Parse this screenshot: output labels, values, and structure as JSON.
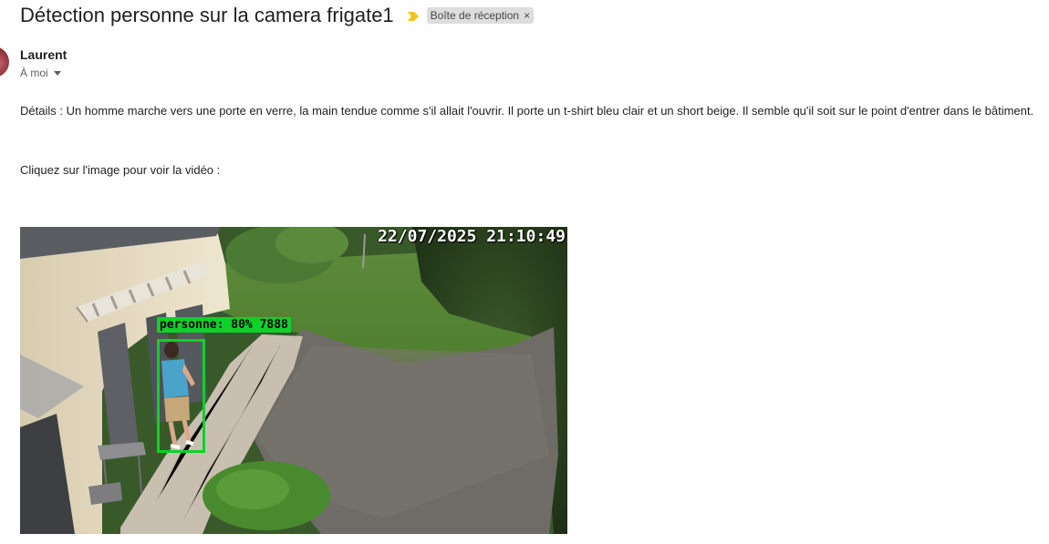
{
  "email": {
    "subject": "Détection personne sur la camera frigate1",
    "label": "Boîte de réception",
    "label_close": "×",
    "sender": "Laurent",
    "recipient": "À moi",
    "details": "Détails : Un homme marche vers une porte en verre, la main tendue comme s'il allait l'ouvrir. Il porte un t-shirt bleu clair et un short beige. Il semble qu'il soit sur le point d'entrer dans le bâtiment.",
    "cta": "Cliquez sur l'image pour voir la vidéo :"
  },
  "snapshot": {
    "timestamp": "22/07/2025 21:10:49",
    "detection_label": "personne: 80% 7888",
    "detection_color": "#0ed12a"
  },
  "colors": {
    "importance_marker": "#f4c21a",
    "label_bg": "#dddddd"
  },
  "icons": {
    "importance": "importance-marker-icon",
    "recipient_details": "caret-down-icon"
  }
}
